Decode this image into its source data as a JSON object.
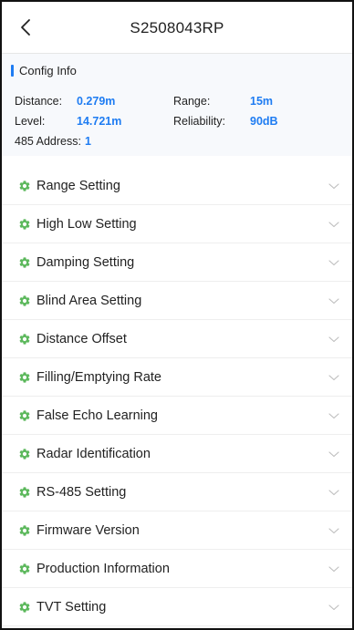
{
  "header": {
    "title": "S2508043RP",
    "back_icon": "chevron-left-icon"
  },
  "config": {
    "title": "Config Info",
    "accent_color": "#1e7cf2",
    "distance": {
      "label": "Distance:",
      "value": "0.279m"
    },
    "range": {
      "label": "Range:",
      "value": "15m"
    },
    "level": {
      "label": "Level:",
      "value": "14.721m"
    },
    "reliability": {
      "label": "Reliability:",
      "value": "90dB"
    },
    "address": {
      "label": "485 Address:",
      "value": "1"
    }
  },
  "menu": {
    "icon": "gear-icon",
    "icon_color": "#5cb85c",
    "expand_icon": "chevron-down-icon",
    "items": [
      {
        "label": "Range Setting"
      },
      {
        "label": "High Low Setting"
      },
      {
        "label": "Damping Setting"
      },
      {
        "label": "Blind Area Setting"
      },
      {
        "label": "Distance Offset"
      },
      {
        "label": "Filling/Emptying Rate"
      },
      {
        "label": "False Echo Learning"
      },
      {
        "label": "Radar Identification"
      },
      {
        "label": "RS-485 Setting"
      },
      {
        "label": "Firmware Version"
      },
      {
        "label": "Production Information"
      },
      {
        "label": "TVT Setting"
      }
    ]
  }
}
